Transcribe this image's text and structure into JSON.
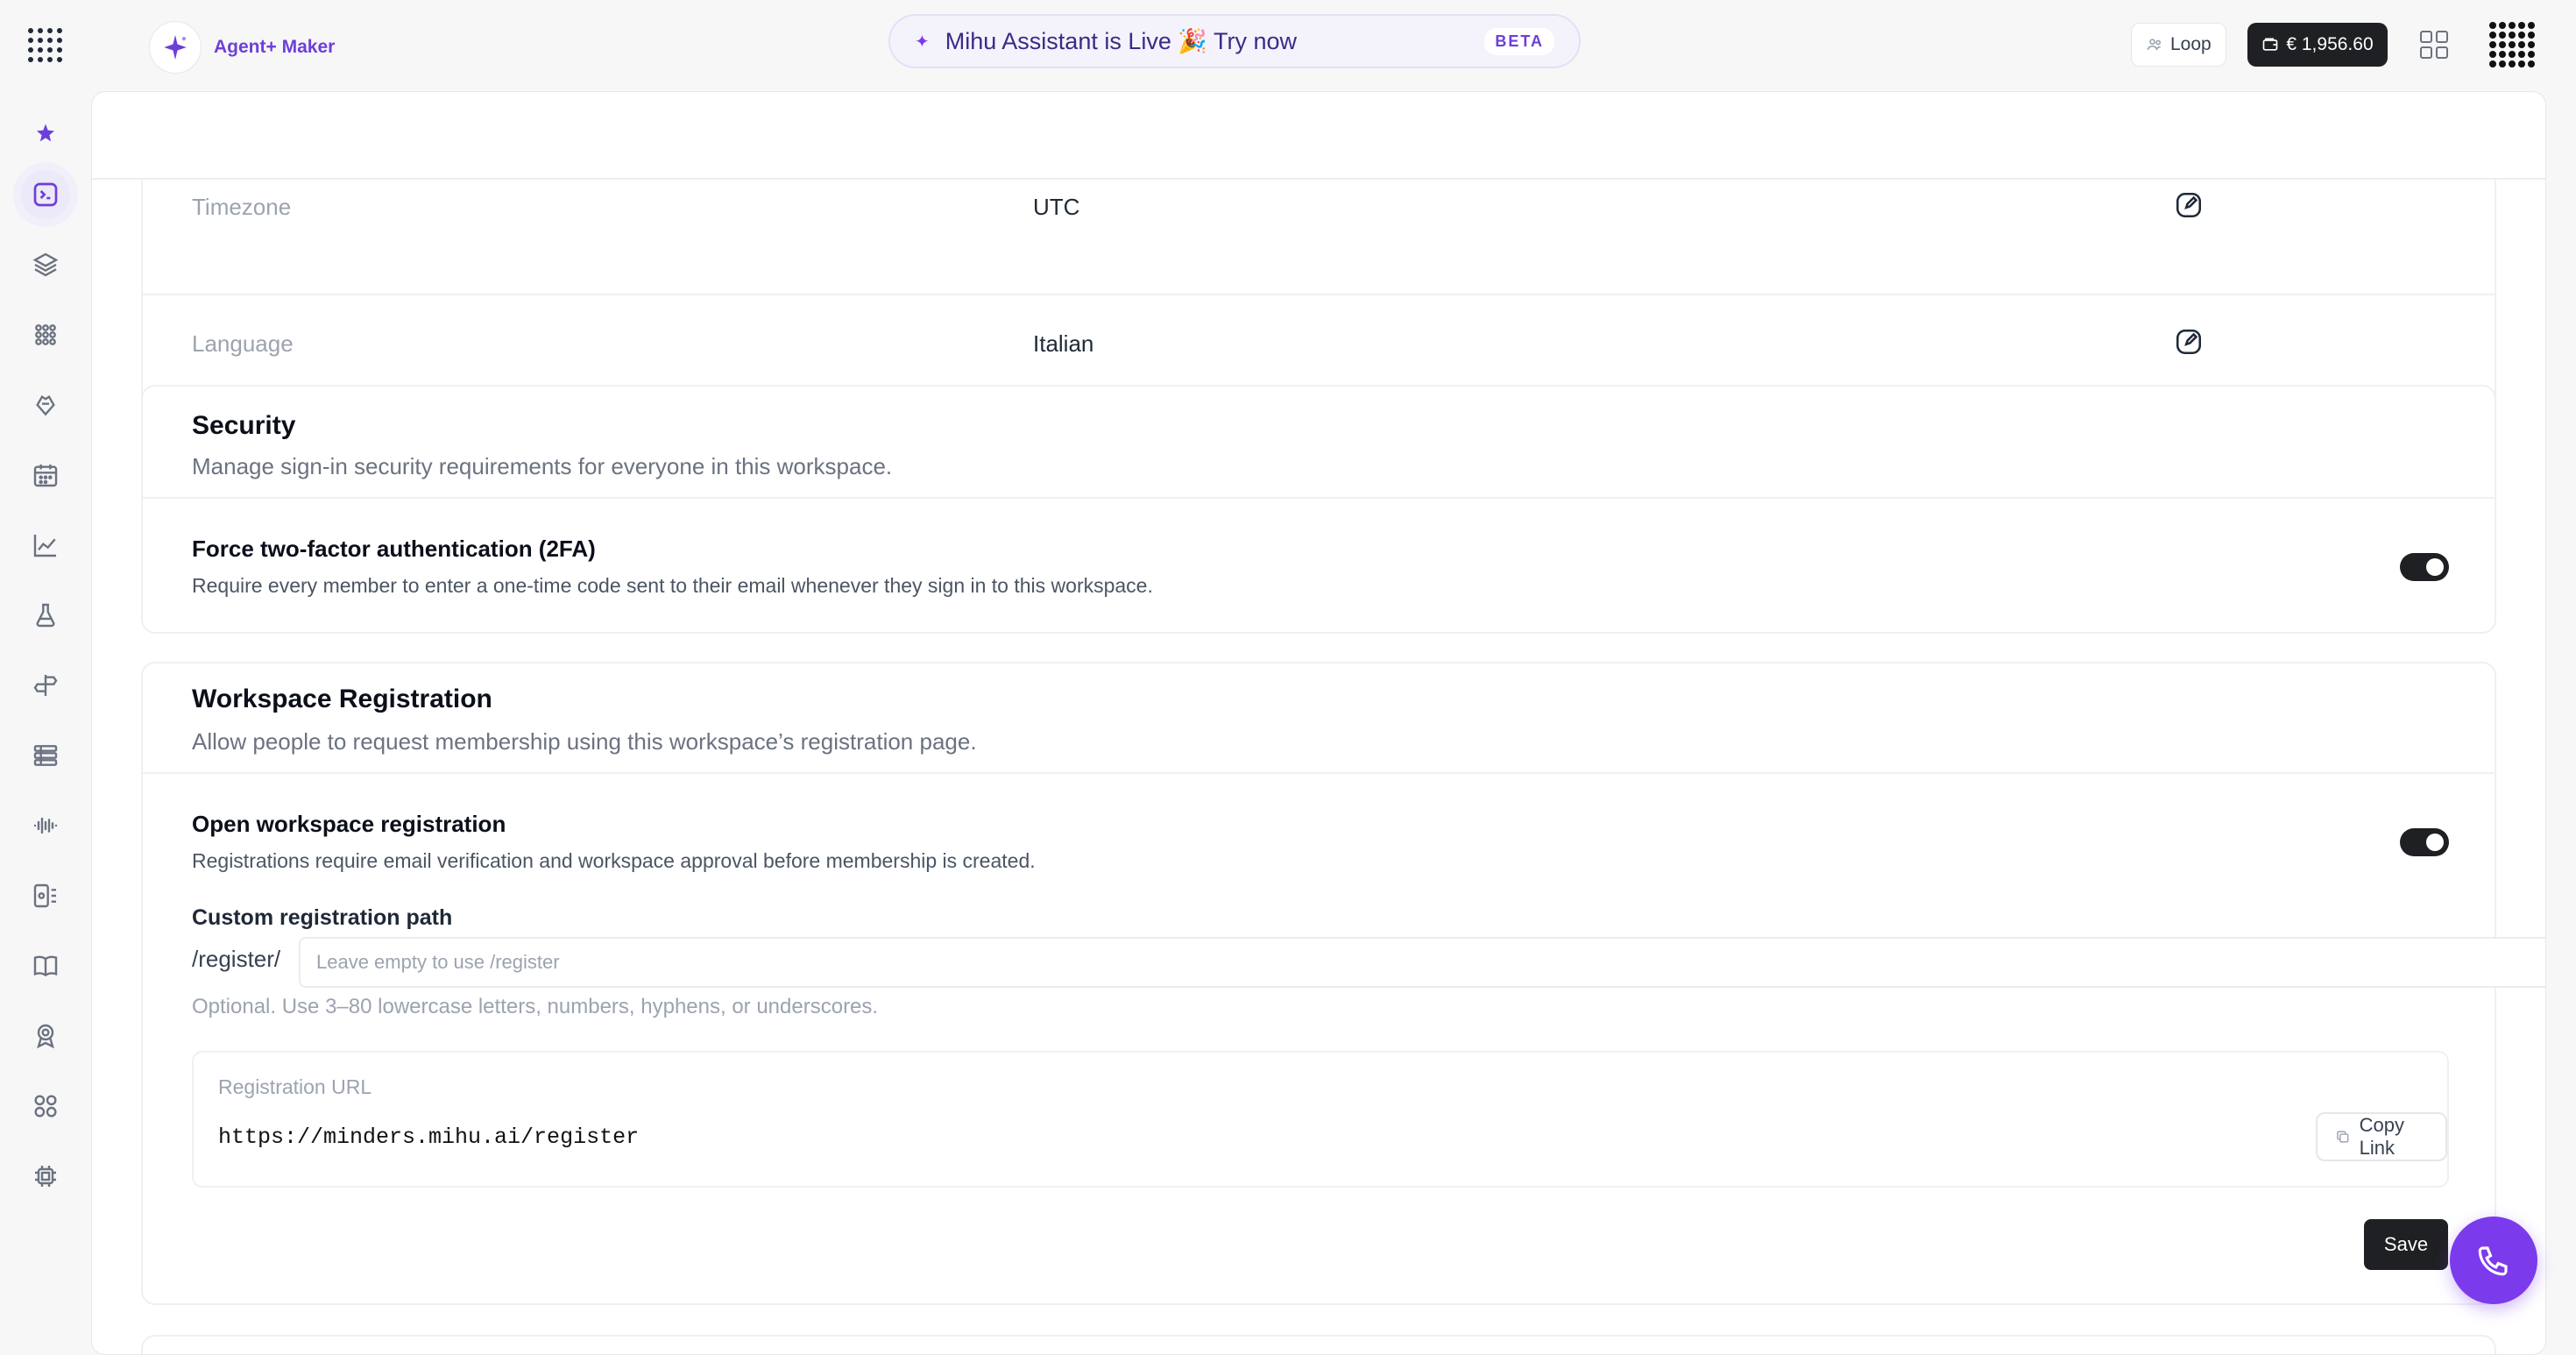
{
  "topbar": {
    "brand": "Agent+ Maker",
    "promo_text": "Mihu Assistant is Live 🎉 Try now",
    "promo_badge": "BETA",
    "loop_label": "Loop",
    "wallet_balance": "€ 1,956.60"
  },
  "general": {
    "rows": [
      {
        "label": "Timezone",
        "value": "UTC"
      },
      {
        "label": "Language",
        "value": "Italian"
      }
    ]
  },
  "security": {
    "title": "Security",
    "description": "Manage sign-in security requirements for everyone in this workspace.",
    "option_title": "Force two-factor authentication (2FA)",
    "option_description": "Require every member to enter a one-time code sent to their email whenever they sign in to this workspace.",
    "enabled": true
  },
  "registration": {
    "title": "Workspace Registration",
    "description": "Allow people to request membership using this workspace’s registration page.",
    "option_title": "Open workspace registration",
    "option_description": "Registrations require email verification and workspace approval before membership is created.",
    "enabled": true,
    "path_label": "Custom registration path",
    "path_prefix": "/register/",
    "path_placeholder": "Leave empty to use /register",
    "path_value": "",
    "hint": "Optional. Use 3–80 lowercase letters, numbers, hyphens, or underscores.",
    "url_label": "Registration URL",
    "url_value": "https://minders.mihu.ai/register",
    "copy_label": "Copy Link",
    "save_label": "Save"
  },
  "icons": {
    "sidebar": [
      "star-icon",
      "terminal-icon",
      "layers-icon",
      "grid-icon",
      "bot-hand-icon",
      "calendar-icon",
      "chart-icon",
      "flask-icon",
      "signpost-icon",
      "list-icon",
      "waveform-icon",
      "device-list-icon",
      "book-icon",
      "award-icon",
      "apps-icon",
      "chip-icon"
    ]
  },
  "colors": {
    "accent": "#7c3aed",
    "dark": "#1f2023"
  }
}
